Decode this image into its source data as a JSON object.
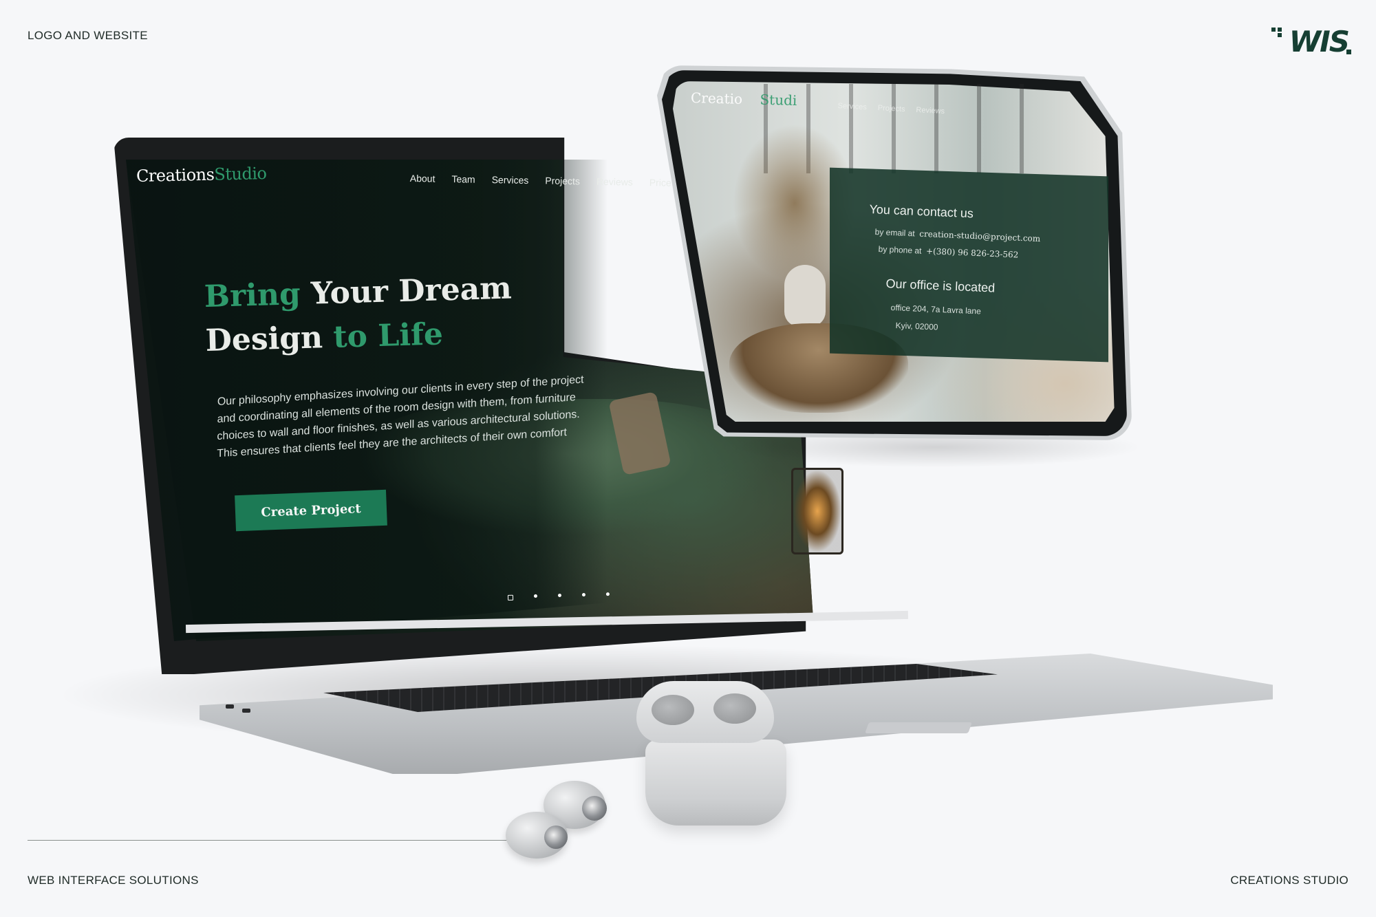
{
  "corners": {
    "top_left": "LOGO AND WEBSITE",
    "bottom_left": "WEB INTERFACE SOLUTIONS",
    "bottom_right": "CREATIONS STUDIO"
  },
  "logo": {
    "text": "WIS",
    "color": "#163f33"
  },
  "laptop_site": {
    "brand": {
      "part1": "Creations",
      "part2": "Studio"
    },
    "nav": [
      "About",
      "Team",
      "Services",
      "Projects",
      "Reviews",
      "Price"
    ],
    "hero": {
      "title_green1": "Bring",
      "title_white1": " Your Dream",
      "title_white2": "Design",
      "title_green2": " to Life",
      "body": "Our philosophy emphasizes involving our clients in every step of the project and coordinating all elements of the room design with them, from furniture choices to wall and floor finishes, as well as various architectural solutions. This ensures that clients feel they are the architects of their own comfort",
      "button_label": "Create Project"
    },
    "carousel": {
      "count": 5,
      "active_index": 0
    },
    "colors": {
      "accent": "#2f9a6c",
      "button": "#1c7a55",
      "bg": "#0c1513"
    }
  },
  "tablet_site": {
    "brand": {
      "part1": "Creatio",
      "part2": "Studi"
    },
    "nav": [
      "Services",
      "Projects",
      "Reviews"
    ],
    "contact": {
      "heading": "You can contact us",
      "email_prefix": "by email at",
      "email": "creation-studio@project.com",
      "phone_prefix": "by phone at",
      "phone": "+(380) 96 826-23-562"
    },
    "office": {
      "heading": "Our office is located",
      "address_line1": "office 204, 7a Lavra lane",
      "address_line2": "Kyiv, 02000"
    }
  },
  "icons": {
    "logo": "wis-logo-icon",
    "airpods": "earbuds-case-icon"
  }
}
